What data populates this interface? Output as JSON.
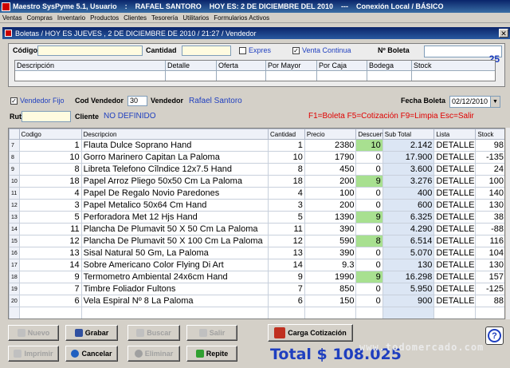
{
  "app_title": {
    "program": "Maestro SysPyme 5.1,  Usuario",
    "sep": ":",
    "user": "RAFAEL SANTORO",
    "date": "HOY ES: 2 DE DICIEMBRE DEL 2010",
    "dots": "---",
    "connection": "Conexión Local / BÁSICO"
  },
  "menu": [
    "Ventas",
    "Compras",
    "Inventario",
    "Productos",
    "Clientes",
    "Tesorería",
    "Utilitarios",
    "Formularios Activos"
  ],
  "window_title": "Boletas / HOY ES JUEVES , 2 DE  DICIEMBRE DE 2010 / 21:27 / Vendedor",
  "header": {
    "codigo_label": "Código",
    "cantidad_label": "Cantidad",
    "expres_label": "Expres",
    "venta_continua_label": "Venta Continua",
    "nboleta_label": "Nº Boleta",
    "nboleta_value": "25"
  },
  "mini_grid_columns": [
    "Descripción",
    "Detalle",
    "Oferta",
    "Por Mayor",
    "Por Caja",
    "Bodega",
    "Stock"
  ],
  "seller": {
    "vendedor_fijo_label": "Vendedor Fijo",
    "cod_vendedor_label": "Cod Vendedor",
    "cod_vendedor_value": "30",
    "vendedor_label": "Vendedor",
    "vendedor_value": "Rafael Santoro",
    "fecha_boleta_label": "Fecha Boleta",
    "fecha_boleta_value": "02/12/2010",
    "rut_label": "Rut",
    "cliente_label": "Cliente",
    "cliente_value": "NO DEFINIDO",
    "shortcuts": "F1=Boleta F5=Cotización  F9=Limpia Esc=Salir"
  },
  "grid": {
    "columns": [
      "Codigo",
      "Descripcion",
      "Cantidad",
      "Precio",
      "Descuen",
      "Sub Total",
      "Lista",
      "Stock"
    ],
    "rows": [
      {
        "n": "7",
        "codigo": "1",
        "desc": "Flauta Dulce Soprano Hand",
        "cant": "1",
        "precio": "2380",
        "desc_pct": "10",
        "subtotal": "2.142",
        "lista": "DETALLE",
        "stock": "98",
        "hl": true
      },
      {
        "n": "8",
        "codigo": "10",
        "desc": "Gorro Marinero Capitan La Paloma",
        "cant": "10",
        "precio": "1790",
        "desc_pct": "0",
        "subtotal": "17.900",
        "lista": "DETALLE",
        "stock": "-135",
        "hl": false
      },
      {
        "n": "9",
        "codigo": "8",
        "desc": "Libreta Telefono Cîlndice 12x7.5 Hand",
        "cant": "8",
        "precio": "450",
        "desc_pct": "0",
        "subtotal": "3.600",
        "lista": "DETALLE",
        "stock": "24",
        "hl": false
      },
      {
        "n": "10",
        "codigo": "18",
        "desc": "Papel Arroz Pliego 50x50 Cm La Paloma",
        "cant": "18",
        "precio": "200",
        "desc_pct": "9",
        "subtotal": "3.276",
        "lista": "DETALLE",
        "stock": "100",
        "hl": true
      },
      {
        "n": "11",
        "codigo": "4",
        "desc": "Papel De Regalo Novio Paredones",
        "cant": "4",
        "precio": "100",
        "desc_pct": "0",
        "subtotal": "400",
        "lista": "DETALLE",
        "stock": "140",
        "hl": false
      },
      {
        "n": "12",
        "codigo": "3",
        "desc": "Papel Metalico 50x64 Cm Hand",
        "cant": "3",
        "precio": "200",
        "desc_pct": "0",
        "subtotal": "600",
        "lista": "DETALLE",
        "stock": "130",
        "hl": false
      },
      {
        "n": "13",
        "codigo": "5",
        "desc": "Perforadora Met 12 Hjs Hand",
        "cant": "5",
        "precio": "1390",
        "desc_pct": "9",
        "subtotal": "6.325",
        "lista": "DETALLE",
        "stock": "38",
        "hl": true
      },
      {
        "n": "14",
        "codigo": "11",
        "desc": "Plancha De Plumavit 50 X 50 Cm La Paloma",
        "cant": "11",
        "precio": "390",
        "desc_pct": "0",
        "subtotal": "4.290",
        "lista": "DETALLE",
        "stock": "-88",
        "hl": false
      },
      {
        "n": "15",
        "codigo": "12",
        "desc": "Plancha De Plumavit 50 X 100 Cm La Paloma",
        "cant": "12",
        "precio": "590",
        "desc_pct": "8",
        "subtotal": "6.514",
        "lista": "DETALLE",
        "stock": "116",
        "hl": true
      },
      {
        "n": "16",
        "codigo": "13",
        "desc": "Sisal Natural 50 Gm, La Paloma",
        "cant": "13",
        "precio": "390",
        "desc_pct": "0",
        "subtotal": "5.070",
        "lista": "DETALLE",
        "stock": "104",
        "hl": false
      },
      {
        "n": "17",
        "codigo": "14",
        "desc": "Sobre Americano  Color Flying Di Art",
        "cant": "14",
        "precio": "9.3",
        "desc_pct": "0",
        "subtotal": "130",
        "lista": "DETALLE",
        "stock": "130",
        "hl": false
      },
      {
        "n": "18",
        "codigo": "9",
        "desc": "Termometro Ambiental 24x6cm Hand",
        "cant": "9",
        "precio": "1990",
        "desc_pct": "9",
        "subtotal": "16.298",
        "lista": "DETALLE",
        "stock": "157",
        "hl": true
      },
      {
        "n": "19",
        "codigo": "7",
        "desc": "Timbre Foliador Fultons",
        "cant": "7",
        "precio": "850",
        "desc_pct": "0",
        "subtotal": "5.950",
        "lista": "DETALLE",
        "stock": "-125",
        "hl": false
      },
      {
        "n": "20",
        "codigo": "6",
        "desc": "Vela Espiral Nº 8 La Paloma",
        "cant": "6",
        "precio": "150",
        "desc_pct": "0",
        "subtotal": "900",
        "lista": "DETALLE",
        "stock": "88",
        "hl": false
      }
    ]
  },
  "buttons": {
    "nuevo": "Nuevo",
    "grabar": "Grabar",
    "buscar": "Buscar",
    "salir": "Salir",
    "imprimir": "Imprimir",
    "cancelar": "Cancelar",
    "eliminar": "Eliminar",
    "repite": "Repite",
    "carga_cotizacion": "Carga Cotización"
  },
  "total": "Total $ 108.025",
  "watermark": "www.todomercado.com",
  "colors": {
    "title_blue": "#0a246a",
    "accent_blue": "#1f3fbf",
    "highlight_green": "#a8e090",
    "subtotal_bg": "#dce6f4",
    "red": "#e00000"
  }
}
